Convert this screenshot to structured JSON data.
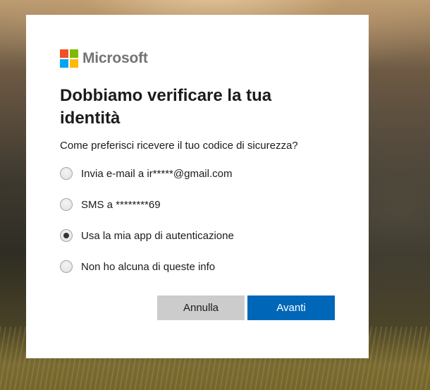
{
  "brand": {
    "name": "Microsoft",
    "logo_colors": [
      "#f25022",
      "#7fba00",
      "#00a4ef",
      "#ffb900"
    ]
  },
  "dialog": {
    "title": "Dobbiamo verificare la tua identità",
    "question": "Come preferisci ricevere il tuo codice di sicurezza?",
    "options": [
      {
        "label": "Invia e-mail a ir*****@gmail.com",
        "selected": false
      },
      {
        "label": "SMS a ********69",
        "selected": false
      },
      {
        "label": "Usa la mia app di autenticazione",
        "selected": true
      },
      {
        "label": "Non ho alcuna di queste info",
        "selected": false
      }
    ],
    "cancel_label": "Annulla",
    "next_label": "Avanti"
  },
  "colors": {
    "primary": "#0067b8",
    "secondary": "#cccccc"
  }
}
